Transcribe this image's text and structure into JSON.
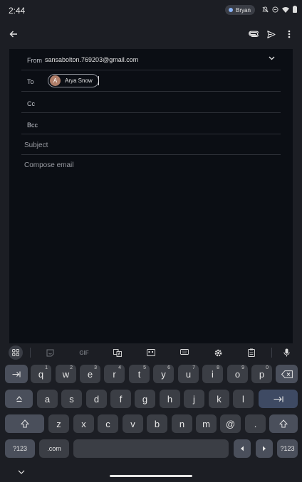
{
  "status_bar": {
    "time": "2:44",
    "user": "Bryan",
    "icons": [
      "silent-bell-icon",
      "do-not-disturb-icon",
      "wifi-icon",
      "battery-icon"
    ]
  },
  "app_bar": {
    "icons": [
      "back-arrow-icon",
      "attach-icon",
      "send-icon",
      "more-vert-icon"
    ]
  },
  "compose": {
    "from_label": "From",
    "from_value": "sansabolton.769203@gmail.com",
    "to_label": "To",
    "to_chip": {
      "avatar_letter": "A",
      "name": "Arya Snow"
    },
    "cc_label": "Cc",
    "bcc_label": "Bcc",
    "subject_placeholder": "Subject",
    "body_placeholder": "Compose email"
  },
  "keyboard": {
    "toolbar": {
      "gif_label": "GIF",
      "icons": [
        "apps-grid-icon",
        "sticker-icon",
        "gif-icon",
        "translate-icon",
        "one-handed-icon",
        "keyboard-layout-icon",
        "settings-icon",
        "clipboard-icon",
        "mic-icon"
      ]
    },
    "row1": [
      {
        "k": "q",
        "h": "1"
      },
      {
        "k": "w",
        "h": "2"
      },
      {
        "k": "e",
        "h": "3"
      },
      {
        "k": "r",
        "h": "4"
      },
      {
        "k": "t",
        "h": "5"
      },
      {
        "k": "y",
        "h": "6"
      },
      {
        "k": "u",
        "h": "7"
      },
      {
        "k": "i",
        "h": "8"
      },
      {
        "k": "o",
        "h": "9"
      },
      {
        "k": "p",
        "h": "0"
      }
    ],
    "row2": [
      "a",
      "s",
      "d",
      "f",
      "g",
      "h",
      "j",
      "k",
      "l"
    ],
    "row3": [
      "z",
      "x",
      "c",
      "v",
      "b",
      "n",
      "m",
      "@",
      "."
    ],
    "symbols_label": "?123",
    "dotcom_label": ".com",
    "symbols_label_right": "?123"
  },
  "colors": {
    "background": "#1c1e24",
    "compose_background": "#0b0e14",
    "key": "#3b3e45",
    "function_key": "#4a4f5b",
    "accent_key": "#3e4a63",
    "avatar": "#b07f6a"
  }
}
